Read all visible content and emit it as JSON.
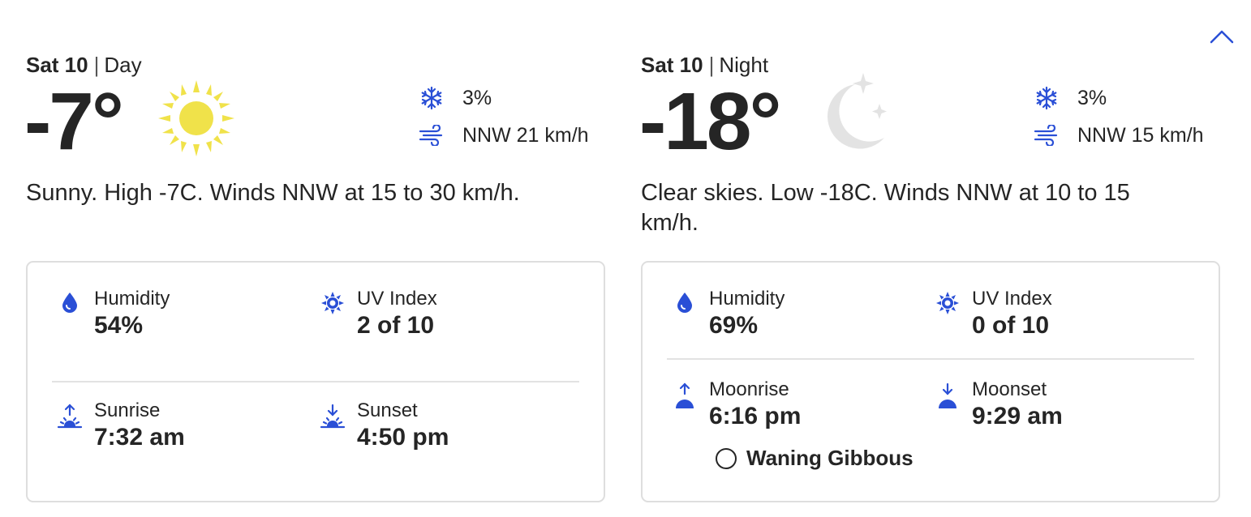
{
  "day": {
    "date_label": "Sat 10",
    "period": "Day",
    "temperature": "-7°",
    "condition_icon": "sun-icon",
    "precip_chance": "3%",
    "wind": "NNW 21 km/h",
    "narrative": "Sunny. High -7C. Winds NNW at 15 to 30 km/h.",
    "humidity_label": "Humidity",
    "humidity_value": "54%",
    "uv_label": "UV Index",
    "uv_value": "2 of 10",
    "sunrise_label": "Sunrise",
    "sunrise_value": "7:32 am",
    "sunset_label": "Sunset",
    "sunset_value": "4:50 pm"
  },
  "night": {
    "date_label": "Sat 10",
    "period": "Night",
    "temperature": "-18°",
    "condition_icon": "moon-stars-icon",
    "precip_chance": "3%",
    "wind": "NNW 15 km/h",
    "narrative": "Clear skies. Low -18C. Winds NNW at 10 to 15 km/h.",
    "humidity_label": "Humidity",
    "humidity_value": "69%",
    "uv_label": "UV Index",
    "uv_value": "0 of 10",
    "moonrise_label": "Moonrise",
    "moonrise_value": "6:16 pm",
    "moonset_label": "Moonset",
    "moonset_value": "9:29 am",
    "moon_phase": "Waning Gibbous"
  },
  "colors": {
    "accent_blue": "#2a4fd6",
    "sun_yellow": "#f0e24a",
    "moon_gray": "#e3e3e3",
    "text": "#252525",
    "border": "#dedede"
  }
}
